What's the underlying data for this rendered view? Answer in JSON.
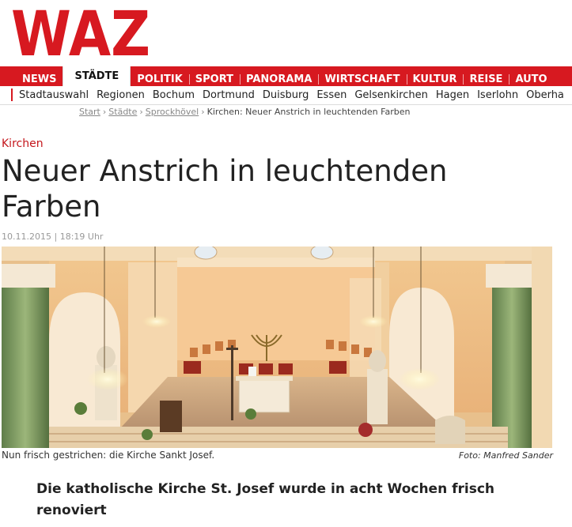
{
  "brand": {
    "logo_text": "WAZ",
    "color": "#d71920"
  },
  "nav": {
    "items": [
      "NEWS",
      "STÄDTE",
      "POLITIK",
      "SPORT",
      "PANORAMA",
      "WIRTSCHAFT",
      "KULTUR",
      "REISE",
      "AUTO"
    ],
    "active": "STÄDTE"
  },
  "subnav": {
    "items": [
      "Stadtauswahl",
      "Regionen",
      "Bochum",
      "Dortmund",
      "Duisburg",
      "Essen",
      "Gelsenkirchen",
      "Hagen",
      "Iserlohn",
      "Oberha"
    ]
  },
  "breadcrumb": {
    "links": [
      "Start",
      "Städte",
      "Sprockhövel"
    ],
    "separator": "›",
    "current": "Kirchen: Neuer Anstrich in leuchtenden Farben"
  },
  "article": {
    "kicker": "Kirchen",
    "headline": "Neuer Anstrich in leuchtenden Farben",
    "date": "10.11.2015",
    "date_separator": "|",
    "time": "18:19 Uhr",
    "photo_caption": "Nun frisch gestrichen: die Kirche Sankt Josef.",
    "photo_credit": "Foto: Manfred Sander",
    "teaser": "Die katholische Kirche St. Josef wurde in acht Wochen frisch renoviert"
  }
}
